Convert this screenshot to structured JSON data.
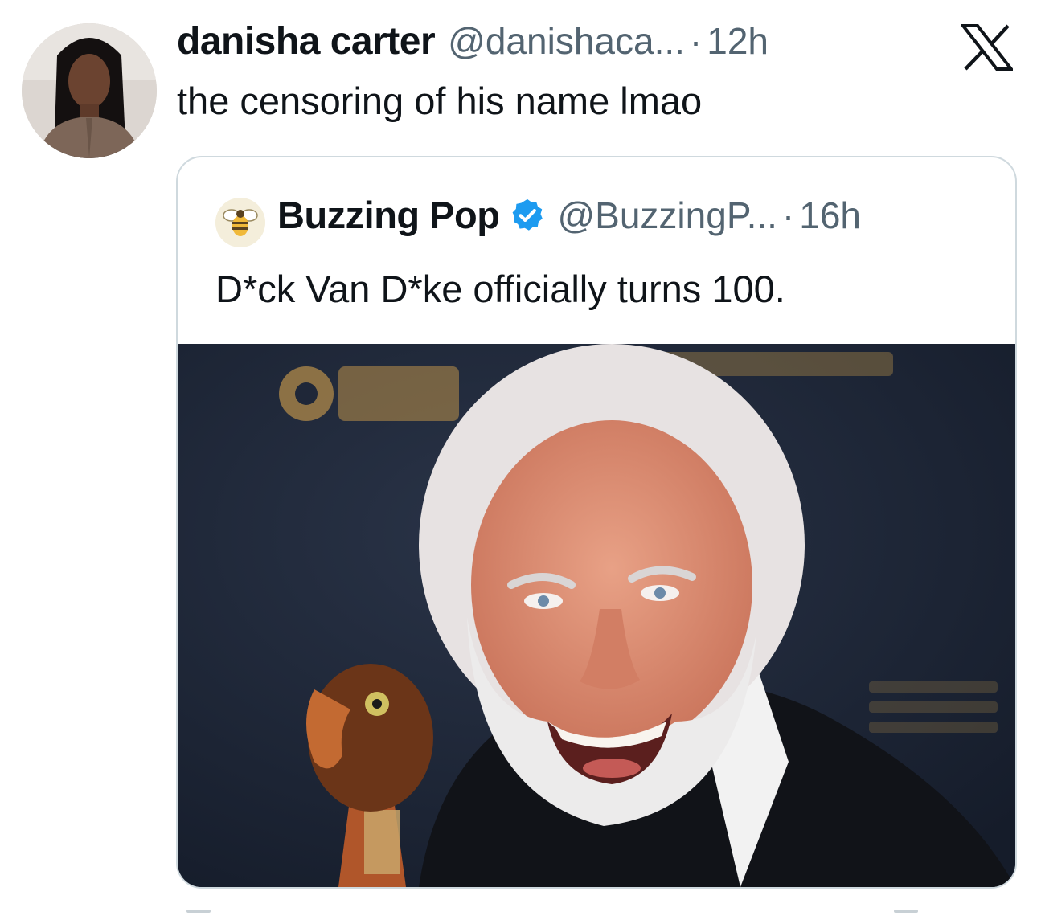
{
  "tweet": {
    "display_name": "danisha carter",
    "handle": "@danishaca...",
    "separator": "·",
    "time": "12h",
    "text": "the censoring of his name lmao",
    "avatar_icon": "profile-photo"
  },
  "quoted_tweet": {
    "display_name": "Buzzing Pop",
    "verified": true,
    "verified_color": "#1d9bf0",
    "handle": "@BuzzingP...",
    "separator": "·",
    "time": "16h",
    "text": "D*ck Van D*ke officially turns 100.",
    "avatar_icon": "bee-icon",
    "media": {
      "type": "photo",
      "backdrop_color": "#1c2436",
      "accent_color": "#b08a4a"
    }
  },
  "platform_icon": "x-logo-icon",
  "colors": {
    "text_primary": "#0f1419",
    "text_secondary": "#536471",
    "border": "#cfd9de"
  }
}
